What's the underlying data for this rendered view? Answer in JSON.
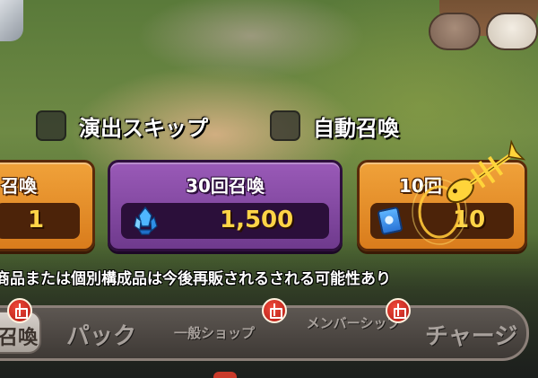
{
  "options": {
    "skip_animation": {
      "label": "演出スキップ",
      "checked": false
    },
    "auto_summon": {
      "label": "自動召喚",
      "checked": false
    }
  },
  "summon_cards": [
    {
      "title": "召喚",
      "cost": "1",
      "currency_icon": "partial-hidden"
    },
    {
      "title": "30回召喚",
      "cost": "1,500",
      "currency_icon": "blue-crystal-icon"
    },
    {
      "title": "10回",
      "cost": "10",
      "currency_icon": "blue-ticket-icon"
    }
  ],
  "notice": "商品または個別構成品は今後再販されるされる可能性あり",
  "tabs": [
    {
      "label": "召喚",
      "active": true,
      "badge": true
    },
    {
      "label": "パック",
      "active": false,
      "badge": false
    },
    {
      "label": "一般ショップ",
      "active": false,
      "badge": true
    },
    {
      "label": "メンバーシップ",
      "active": false,
      "badge": true
    },
    {
      "label": "チャージ",
      "active": false,
      "badge": false
    }
  ],
  "colors": {
    "orange_card": "#e08a24",
    "purple_card": "#7f459e",
    "cost_text": "#ffd447",
    "tab_bar": "#4a4440",
    "badge_red": "#d02a20"
  }
}
